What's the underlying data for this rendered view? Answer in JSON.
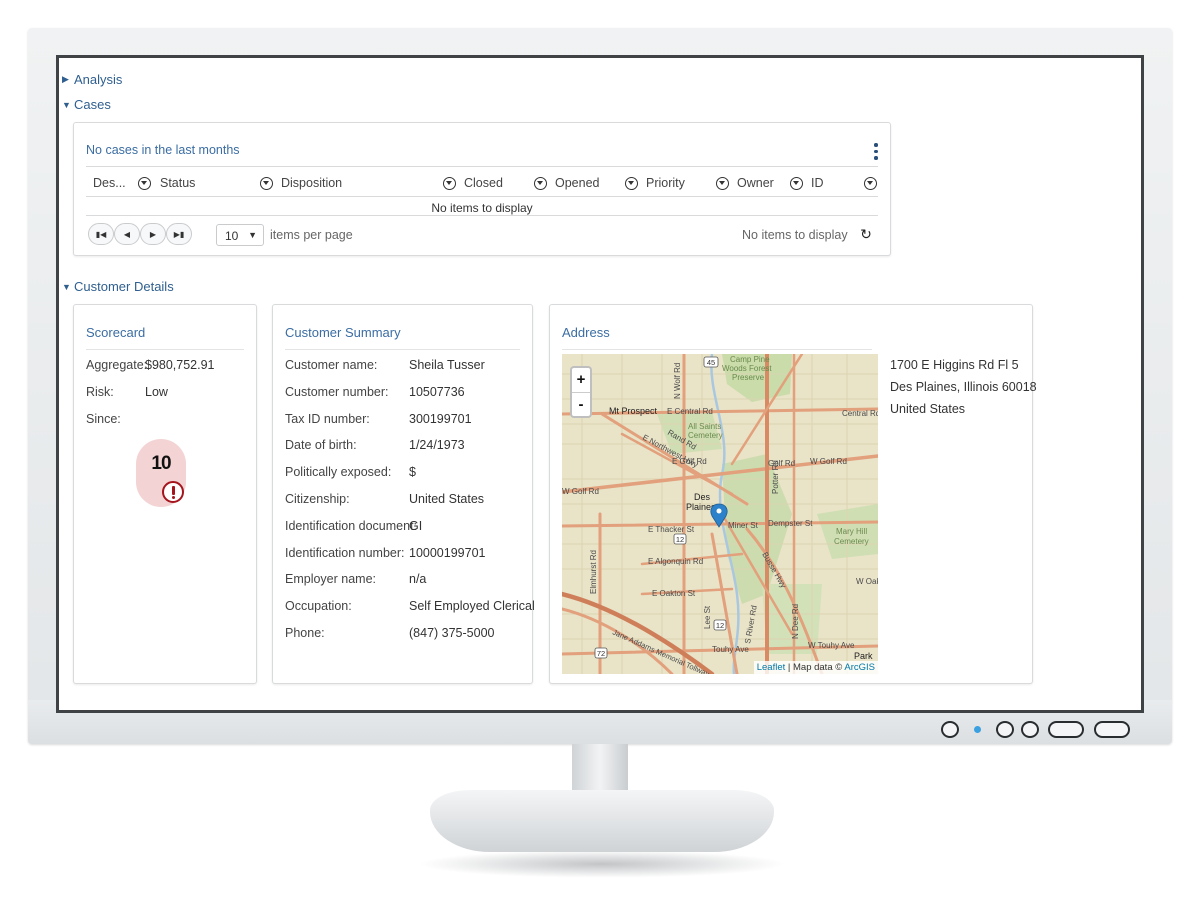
{
  "sections": {
    "analysis": "Analysis",
    "cases": "Cases",
    "customer_details": "Customer Details"
  },
  "cases_panel": {
    "title": "No cases in the last months",
    "columns": [
      "Des...",
      "Status",
      "Disposition",
      "Closed",
      "Opened",
      "Priority",
      "Owner",
      "ID"
    ],
    "empty_message": "No items to display",
    "pager": {
      "page_size": "10",
      "items_per_page_label": "items per page",
      "status": "No items to display"
    }
  },
  "scorecard": {
    "title": "Scorecard",
    "aggregate_label": "Aggregate:",
    "aggregate_value": "$980,752.91",
    "risk_label": "Risk:",
    "risk_value": "Low",
    "since_label": "Since:",
    "score": "10"
  },
  "customer_summary": {
    "title": "Customer Summary",
    "fields": [
      {
        "label": "Customer name:",
        "value": "Sheila Tusser"
      },
      {
        "label": "Customer number:",
        "value": "10507736"
      },
      {
        "label": "Tax ID number:",
        "value": "300199701"
      },
      {
        "label": "Date of birth:",
        "value": "1/24/1973"
      },
      {
        "label": "Politically exposed:",
        "value": "$"
      },
      {
        "label": "Citizenship:",
        "value": "United States"
      },
      {
        "label": "Identification document:",
        "value": "GI"
      },
      {
        "label": "Identification number:",
        "value": "10000199701"
      },
      {
        "label": "Employer name:",
        "value": "n/a"
      },
      {
        "label": "Occupation:",
        "value": "Self Employed Clerical"
      },
      {
        "label": "Phone:",
        "value": "(847) 375-5000"
      }
    ]
  },
  "address": {
    "title": "Address",
    "lines": [
      "1700 E Higgins Rd Fl 5",
      "Des Plaines, Illinois 60018",
      "United States"
    ],
    "map": {
      "zoom_in": "+",
      "zoom_out": "-",
      "attribution_link": "Leaflet",
      "attribution_text": " | Map data © ",
      "attribution_source": "ArcGIS",
      "labels": {
        "mt_prospect": "Mt Prospect",
        "des_plaines_1": "Des",
        "des_plaines_2": "Plaines",
        "w_golf_rd": "W Golf Rd",
        "e_golf_rd": "E Golf Rd",
        "golf_rd": "Golf Rd",
        "w_golf_rd_2": "W Golf Rd",
        "central_rd": "E Central Rd",
        "central_rd_2": "Central Rd",
        "thacker": "E Thacker St",
        "miner": "Miner St",
        "dempster": "Dempster St",
        "algonquin": "E Algonquin Rd",
        "oakton": "E Oakton St",
        "touhy": "Touhy Ave",
        "w_touhy": "W Touhy Ave",
        "park": "Park",
        "camp_pine_1": "Camp Pine",
        "camp_pine_2": "Woods Forest",
        "camp_pine_3": "Preserve",
        "all_saints_1": "All Saints",
        "all_saints_2": "Cemetery",
        "mary_hill_1": "Mary Hill",
        "mary_hill_2": "Cemetery",
        "rand_rd": "Rand Rd",
        "northwest_hwy": "E Northwest Hwy",
        "busse_hwy": "Busse Hwy",
        "jane_addams": "Jane Addams Memorial Tollway",
        "potter_rd": "Potter Rd",
        "elmhurst_rd": "Elmhurst Rd",
        "river_rd": "S River Rd",
        "lee_st": "Lee St",
        "n_dee_rd": "N Dee Rd",
        "n_wolf_rd": "N Wolf Rd",
        "w_oak": "W Oak",
        "hwy_12a": "12",
        "hwy_12b": "12",
        "hwy_45": "45",
        "hwy_72": "72"
      }
    }
  }
}
